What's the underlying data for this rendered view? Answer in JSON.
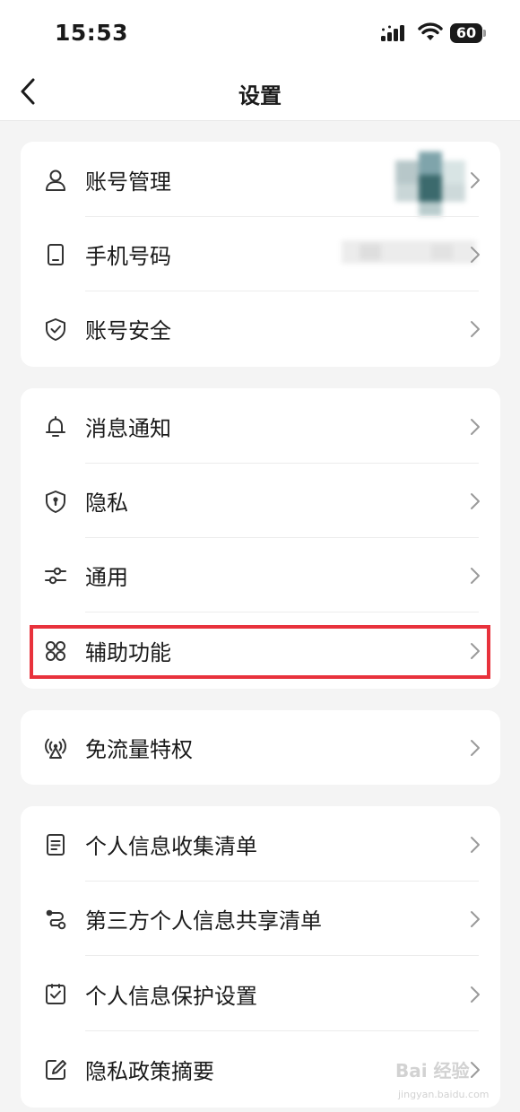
{
  "status_bar": {
    "time": "15:53",
    "battery": "60"
  },
  "nav": {
    "title": "设置"
  },
  "groups": [
    {
      "items": [
        {
          "label": "账号管理",
          "icon": "person-icon"
        },
        {
          "label": "手机号码",
          "icon": "phone-icon"
        },
        {
          "label": "账号安全",
          "icon": "shield-check-icon"
        }
      ]
    },
    {
      "items": [
        {
          "label": "消息通知",
          "icon": "bell-icon"
        },
        {
          "label": "隐私",
          "icon": "shield-keyhole-icon"
        },
        {
          "label": "通用",
          "icon": "sliders-icon"
        },
        {
          "label": "辅助功能",
          "icon": "grid-four-icon"
        }
      ]
    },
    {
      "items": [
        {
          "label": "免流量特权",
          "icon": "broadcast-icon"
        }
      ]
    },
    {
      "items": [
        {
          "label": "个人信息收集清单",
          "icon": "document-icon"
        },
        {
          "label": "第三方个人信息共享清单",
          "icon": "share-nodes-icon"
        },
        {
          "label": "个人信息保护设置",
          "icon": "checkbox-icon"
        },
        {
          "label": "隐私政策摘要",
          "icon": "edit-icon"
        }
      ]
    }
  ],
  "colors": {
    "highlight": "#e8323c",
    "background": "#f4f4f4",
    "card": "#ffffff"
  },
  "watermark": {
    "brand": "Bai 经验",
    "url": "jingyan.baidu.com"
  }
}
